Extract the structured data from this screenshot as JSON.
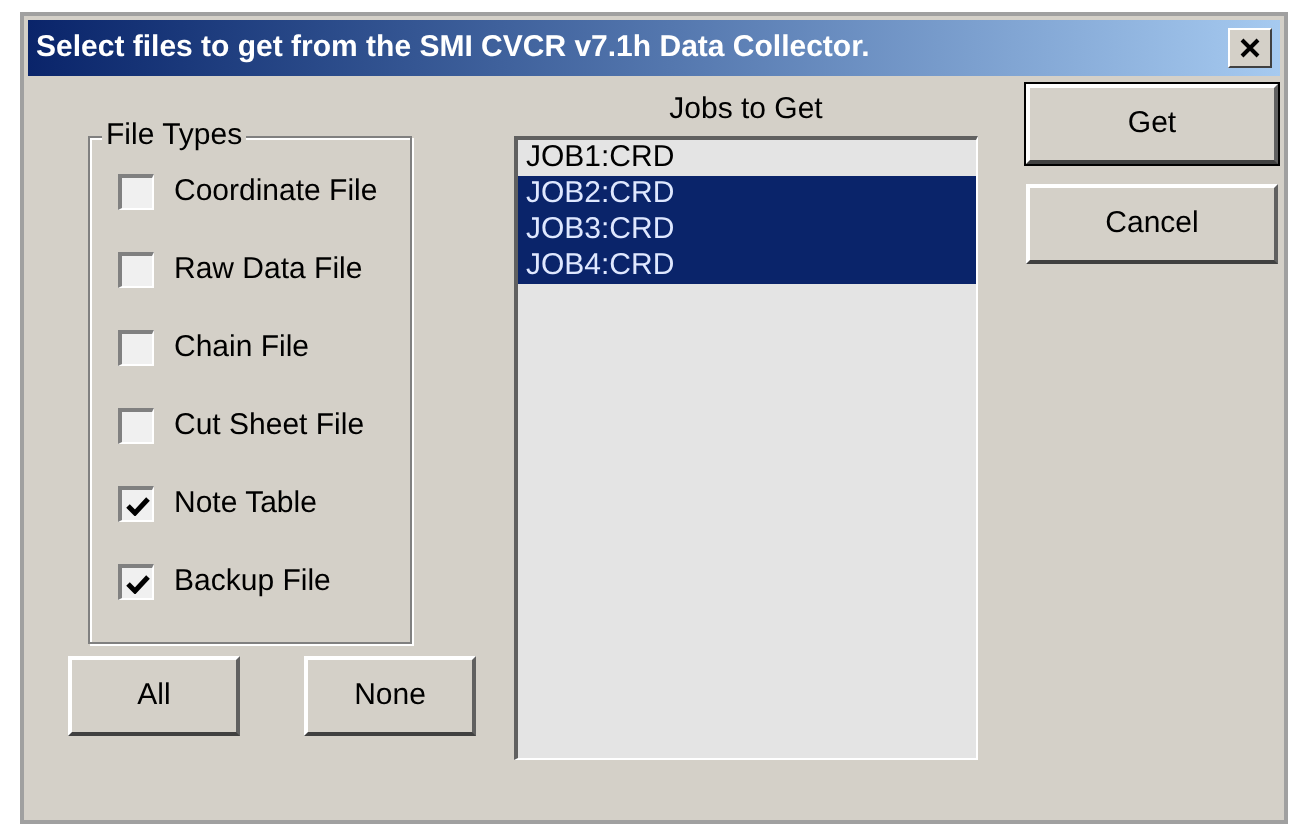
{
  "window": {
    "title": "Select files to get from the SMI CVCR v7.1h Data Collector."
  },
  "file_types": {
    "label": "File Types",
    "items": [
      {
        "label": "Coordinate File",
        "checked": false
      },
      {
        "label": "Raw Data File",
        "checked": false
      },
      {
        "label": "Chain File",
        "checked": false
      },
      {
        "label": "Cut Sheet File",
        "checked": false
      },
      {
        "label": "Note Table",
        "checked": true
      },
      {
        "label": "Backup File",
        "checked": true
      }
    ]
  },
  "selection_buttons": [
    "All",
    "None"
  ],
  "jobs": {
    "label": "Jobs to Get",
    "items": [
      {
        "label": "JOB1:CRD",
        "selected": false
      },
      {
        "label": "JOB2:CRD",
        "selected": true
      },
      {
        "label": "JOB3:CRD",
        "selected": true
      },
      {
        "label": "JOB4:CRD",
        "selected": true
      }
    ]
  },
  "buttons": [
    "Get",
    "Cancel"
  ]
}
